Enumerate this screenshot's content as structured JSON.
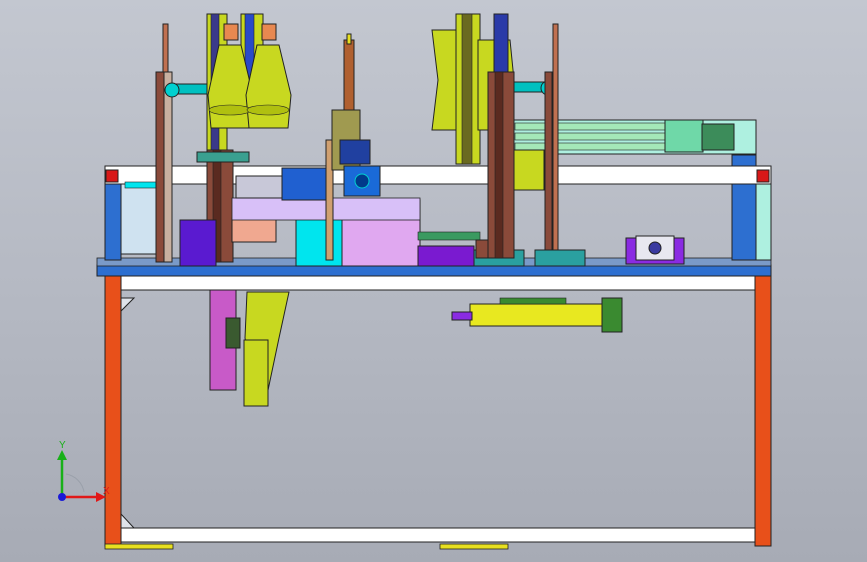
{
  "triad": {
    "x_label": "X",
    "y_label": "Y",
    "x_color": "#e01818",
    "y_color": "#18b018",
    "z_color": "#1a1ad8"
  },
  "palette": {
    "frame_orange": "#e8501a",
    "frame_blue": "#2d6fd0",
    "plate_white": "#ffffff",
    "olive": "#c8d820",
    "purple": "#8a2be2",
    "cyan": "#00e5ee",
    "brown": "#8a4a3a",
    "magenta": "#c85ac8",
    "foot_yellow": "#e8e020"
  }
}
